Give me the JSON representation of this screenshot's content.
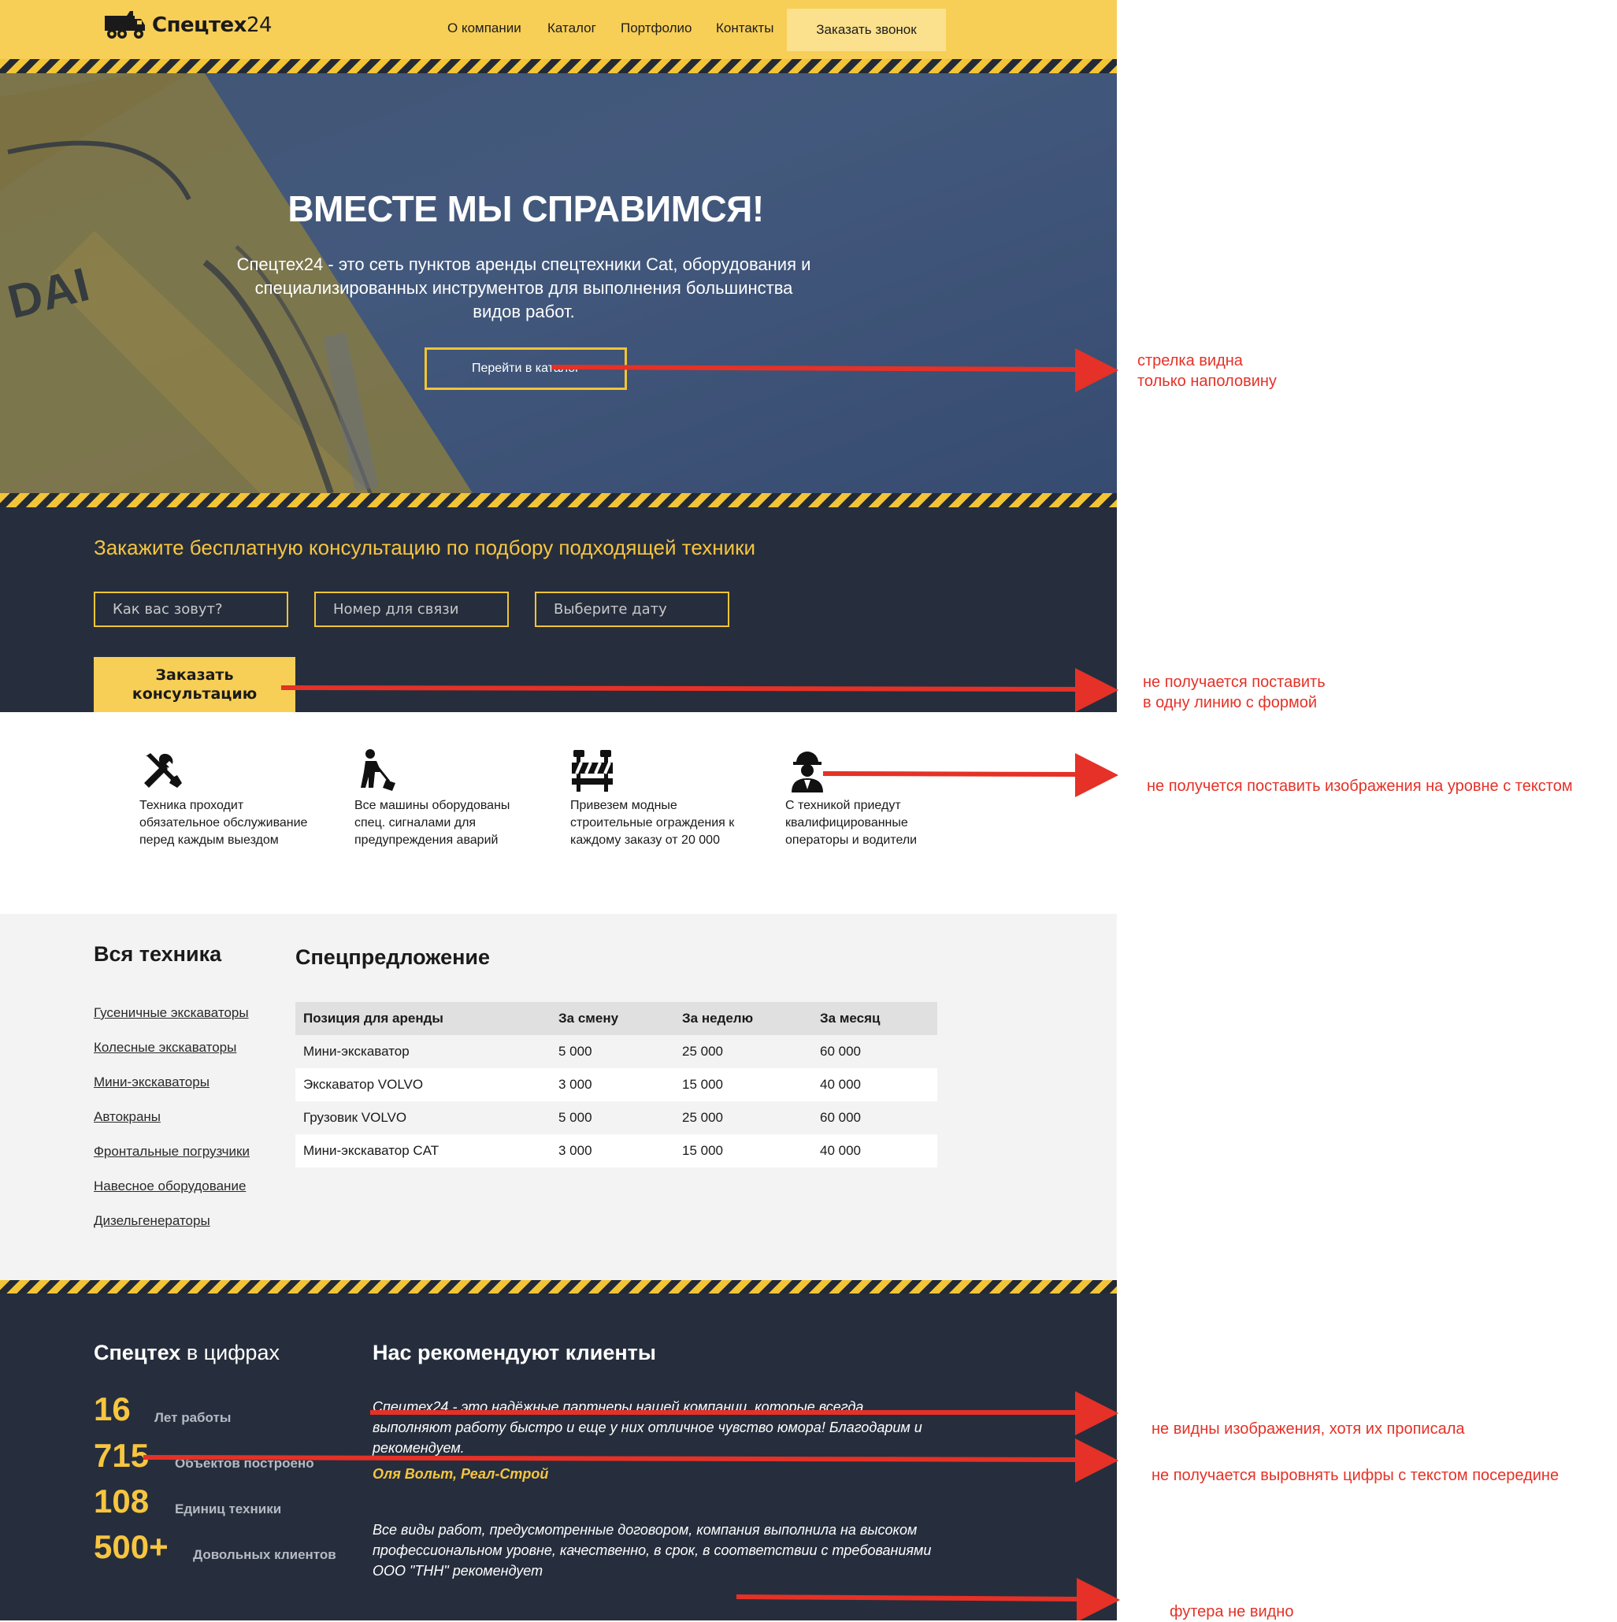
{
  "header": {
    "logo_text": "Спецтех",
    "logo_num": "24",
    "nav": [
      "О компании",
      "Каталог",
      "Портфолио",
      "Контакты"
    ],
    "cta": "Заказать звонок"
  },
  "hero": {
    "title": "ВМЕСТЕ МЫ СПРАВИМСЯ!",
    "text": "Спецтех24 - это сеть пунктов аренды спецтехники Cat, оборудования и специализированных инструментов для выполнения большинства видов работ.",
    "button": "Перейти в каталог",
    "brand_fragment": "DAI"
  },
  "consult": {
    "title": "Закажите бесплатную консультацию по подбору подходящей техники",
    "name_placeholder": "Как вас зовут?",
    "phone_placeholder": "Номер для связи",
    "date_placeholder": "Выберите дату",
    "button": "Заказать консультацию"
  },
  "features": [
    {
      "icon": "tools-icon",
      "text": "Техника проходит обязательное обслуживание перед каждым выездом"
    },
    {
      "icon": "worker-shovel-icon",
      "text": "Все машины оборудованы спец. сигналами для предупреждения аварий"
    },
    {
      "icon": "barrier-icon",
      "text": "Привезем модные строительные ограждения к каждому заказу от 20 000"
    },
    {
      "icon": "operator-icon",
      "text": "С техникой приедут квалифицированные операторы и водители"
    }
  ],
  "catalog": {
    "title": "Вся техника",
    "links": [
      "Гусеничные экскаваторы",
      "Колесные экскаваторы",
      "Мини-экскаваторы",
      "Автокраны",
      "Фронтальные погрузчики",
      "Навесное оборудование",
      "Дизельгенераторы"
    ]
  },
  "special": {
    "title": "Спецпредложение",
    "headers": [
      "Позиция для аренды",
      "За смену",
      "За неделю",
      "За месяц"
    ],
    "rows": [
      [
        "Мини-экскаватор",
        "5 000",
        "25 000",
        "60 000"
      ],
      [
        "Экскаватор VOLVO",
        "3 000",
        "15 000",
        "40 000"
      ],
      [
        "Грузовик VOLVO",
        "5 000",
        "25 000",
        "60 000"
      ],
      [
        "Мини-экскаватор CAT",
        "3 000",
        "15 000",
        "40 000"
      ]
    ]
  },
  "stats": {
    "title_bold": "Спецтех",
    "title_rest": " в цифрах",
    "items": [
      {
        "num": "16",
        "label": "Лет работы"
      },
      {
        "num": "715",
        "label": "Объектов построено"
      },
      {
        "num": "108",
        "label": "Единиц техники"
      },
      {
        "num": "500+",
        "label": "Довольных клиентов"
      }
    ]
  },
  "reviews": {
    "title": "Нас рекомендуют клиенты",
    "items": [
      {
        "text": "Спецтех24 - это надёжные партнеры нашей компании, которые всегда выполняют работу быстро и еще у них отличное чувство юмора! Благодарим и рекомендуем.",
        "author": "Оля Вольт, Реал-Строй"
      },
      {
        "text": "Все виды работ, предусмотренные договором, компания выполнила на высоком профессиональном уровне, качественно, в срок, в соответствии с требованиями ООО \"ТНН\" рекомендует",
        "author": ""
      }
    ]
  },
  "annotations": [
    "стрелка видна",
    "только наполовину",
    "не получается поставить",
    "в одну линию с формой",
    "не получется поставить изображения на уровне с текстом",
    "не видны изображения, хотя их прописала",
    "не получается выровнять цифры с текстом посередине",
    "футера не видно"
  ],
  "colors": {
    "yellow": "#f7ce56",
    "dark": "#262e3d",
    "accent": "#f7c53f",
    "annotation_red": "#e53127"
  }
}
